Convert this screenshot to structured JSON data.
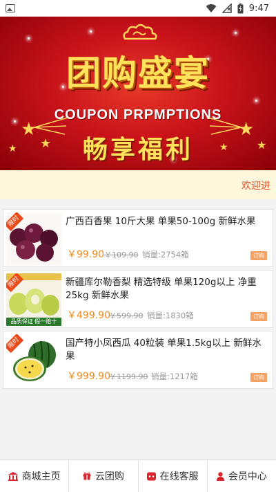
{
  "status_bar": {
    "time": "9:47"
  },
  "banner": {
    "title_cn": "团购盛宴",
    "title_en": "COUPON PRPMPTIONS",
    "subtitle": "畅享福利"
  },
  "welcome": {
    "text": "欢迎进"
  },
  "products": [
    {
      "badge": "限时",
      "name": "广西百香果 10斤大果 单果50-100g 新鲜水果",
      "price": "￥99.90",
      "old_price": "￥109.90",
      "sold": "销量:2754箱",
      "order_label": "订购"
    },
    {
      "badge": "限时",
      "name": "新疆库尔勒香梨 精选特级 单果120g以上 净重25kg 新鲜水果",
      "price": "￥499.90",
      "old_price": "￥599.90",
      "sold": "销量:1830箱",
      "order_label": "订购",
      "thumb_caption": "品质保证 假一赔十"
    },
    {
      "badge": "限时",
      "name": "国产特小凤西瓜 40粒装 单果1.5kg以上 新鲜水果",
      "price": "￥999.90",
      "old_price": "￥1199.90",
      "sold": "销量:1217箱",
      "order_label": "订购"
    }
  ],
  "tabs": [
    {
      "label": "商城主页",
      "icon": "bank-icon"
    },
    {
      "label": "云团购",
      "icon": "gift-icon"
    },
    {
      "label": "在线客服",
      "icon": "chat-icon"
    },
    {
      "label": "会员中心",
      "icon": "user-icon"
    }
  ],
  "colors": {
    "banner_red": "#c8121a",
    "title_gold": "#ffe25a",
    "price_orange": "#f08a1c",
    "accent_red": "#d9232d",
    "welcome_bg": "#fff8dc"
  }
}
